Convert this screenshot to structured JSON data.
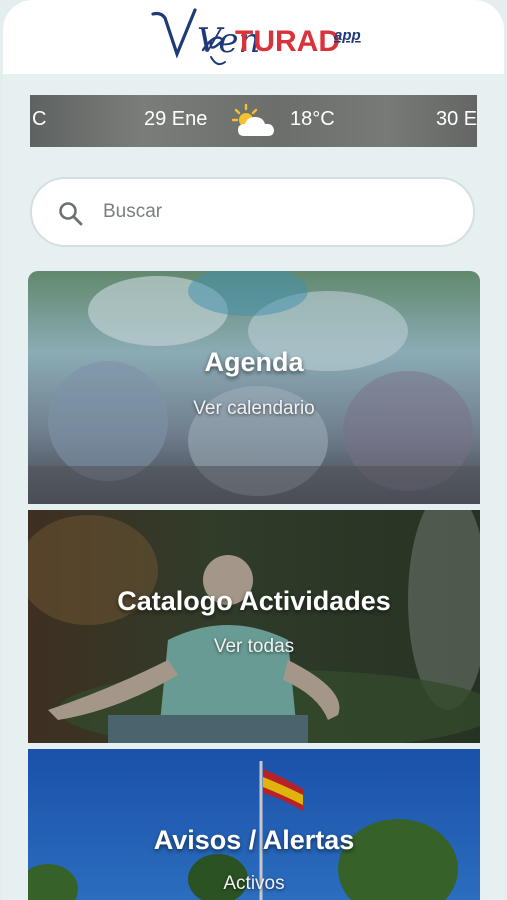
{
  "app": {
    "logo_script": "Ven",
    "logo_caps": "TURAD",
    "logo_sup": "app"
  },
  "weather": {
    "cells": [
      "C",
      "29 Ene",
      "18°C",
      "30 E"
    ],
    "icon": "partly-cloudy-icon"
  },
  "search": {
    "placeholder": "Buscar",
    "icon": "search-icon"
  },
  "cards": [
    {
      "title": "Agenda",
      "subtitle": "Ver calendario"
    },
    {
      "title": "Catalogo Actividades",
      "subtitle": "Ver todas"
    },
    {
      "title": "Avisos / Alertas",
      "subtitle": "Activos"
    }
  ],
  "colors": {
    "brand_navy": "#1f3a78",
    "brand_red": "#d8333b"
  }
}
